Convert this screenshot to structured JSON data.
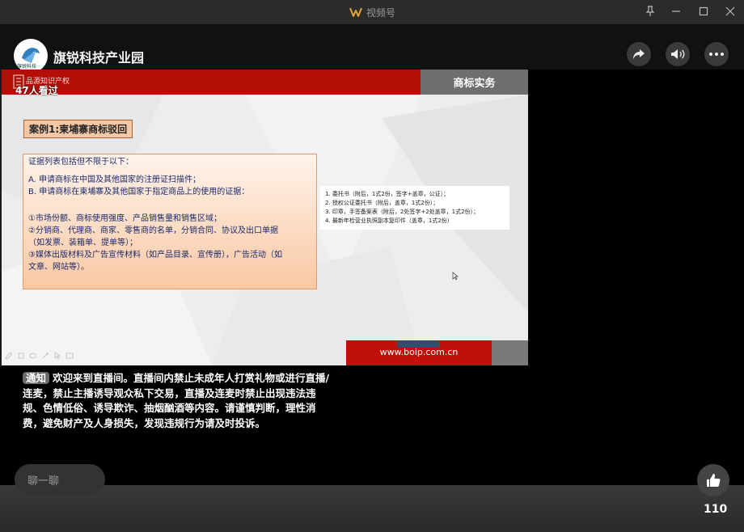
{
  "app": {
    "title": "视频号"
  },
  "channel": {
    "name": "旗锐科技产业园",
    "logo_text": "旗锐科技"
  },
  "slide": {
    "brand": "品源知识产权",
    "viewers": "47人看过",
    "tab_title": "商标实务",
    "case_title": "案例1:柬埔寨商标驳回",
    "evidence_lines": [
      "证据列表包括但不限于以下：",
      "",
      "A. 申请商标在中国及其他国家的注册证扫描件；",
      "B. 申请商标在柬埔寨及其他国家于指定商品上的使用的证据：",
      "",
      "①市场份额、商标使用强度、产品销售量和销售区域；",
      "②分销商、代理商、商家、零售商的名单，分销合同、协议及出口单据",
      "（如发票、装箱单、提单等）；",
      "③媒体出版材料及广告宣传材料（如产品目录、宣传册），广告活动（如",
      "文章、网站等）。"
    ],
    "notes": [
      "1. 委托书（附后，1式2份，签字+盖章，公证）；",
      "2. 授权公证委托书（附后，盖章，1式2份）；",
      "3. 印章，手签备案表（附后，2处签字+2处盖章，1式2份）；",
      "4. 最新年检营业执照副本复印件（盖章，1式2份）"
    ],
    "url": "www.boip.com.cn"
  },
  "notice": {
    "tag": "通知",
    "text": "欢迎来到直播间。直播间内禁止未成年人打赏礼物或进行直播/连麦，禁止主播诱导观众私下交易，直播及连麦时禁止出现违法违规、色情低俗、诱导欺诈、抽烟酗酒等内容。请谨慎判断，理性消费，避免财产及人身损失，发现违规行为请及时投诉。"
  },
  "chat": {
    "placeholder": "聊一聊"
  },
  "likes": {
    "count": "110"
  },
  "colors": {
    "ribbon_red": "#b30f06",
    "app_bg": "#111111"
  }
}
